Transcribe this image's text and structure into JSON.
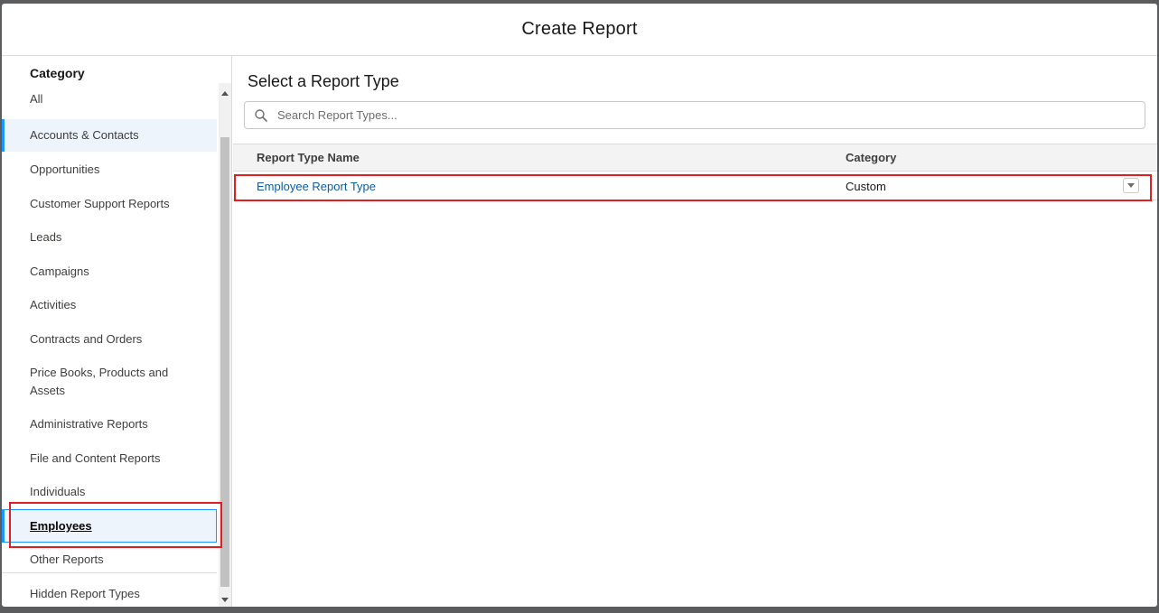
{
  "modal": {
    "title": "Create Report"
  },
  "sidebar": {
    "heading": "Category",
    "items": [
      {
        "label": "All"
      },
      {
        "label": "Accounts & Contacts"
      },
      {
        "label": "Opportunities"
      },
      {
        "label": "Customer Support Reports"
      },
      {
        "label": "Leads"
      },
      {
        "label": "Campaigns"
      },
      {
        "label": "Activities"
      },
      {
        "label": "Contracts and Orders"
      },
      {
        "label": "Price Books, Products and"
      },
      {
        "label": "Assets"
      },
      {
        "label": "Administrative Reports"
      },
      {
        "label": "File and Content Reports"
      },
      {
        "label": "Individuals"
      },
      {
        "label": "Employees"
      },
      {
        "label": "Other Reports"
      },
      {
        "label": "Hidden Report Types"
      }
    ],
    "selected": "Employees"
  },
  "main": {
    "title": "Select a Report Type",
    "search": {
      "placeholder": "Search Report Types..."
    },
    "table": {
      "columns": [
        "Report Type Name",
        "Category"
      ],
      "rows": [
        {
          "name": "Employee Report Type",
          "category": "Custom"
        }
      ]
    }
  },
  "colors": {
    "accent": "#1b96ff",
    "highlight": "#e02020",
    "link": "#0b5cab",
    "selected_bg": "#eef4fc"
  }
}
